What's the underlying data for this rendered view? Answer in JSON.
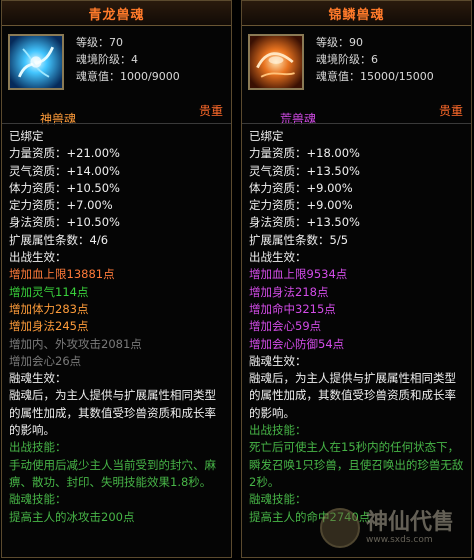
{
  "left": {
    "title": "青龙兽魂",
    "stats": [
      "等级：70",
      "魂境阶级：4",
      "魂意值：1000/9000"
    ],
    "type_label": "神兽魂",
    "type_color": "#ff9c3a",
    "rarity": "贵重",
    "lines": [
      {
        "t": "已绑定",
        "c": "white"
      },
      {
        "t": "力量资质：+21.00%",
        "c": "white"
      },
      {
        "t": "灵气资质：+14.00%",
        "c": "white"
      },
      {
        "t": "体力资质：+10.50%",
        "c": "white"
      },
      {
        "t": "定力资质：+7.00%",
        "c": "white"
      },
      {
        "t": "身法资质：+10.50%",
        "c": "white"
      },
      {
        "t": "扩展属性条数：4/6",
        "c": "white"
      },
      {
        "t": "出战生效：",
        "c": "white"
      },
      {
        "t": "增加血上限13881点",
        "c": "red"
      },
      {
        "t": "增加灵气114点",
        "c": "green"
      },
      {
        "t": "增加体力283点",
        "c": "orange"
      },
      {
        "t": "增加身法245点",
        "c": "orange"
      },
      {
        "t": "增加内、外攻攻击2081点",
        "c": "gray"
      },
      {
        "t": "增加会心26点",
        "c": "gray"
      },
      {
        "t": "融魂生效：",
        "c": "white"
      },
      {
        "t": "融魂后，为主人提供与扩展属性相同类型的属性加成，其数值受珍兽资质和成长率的影响。",
        "c": "white",
        "p": true
      },
      {
        "t": "出战技能：",
        "c": "dgreen"
      },
      {
        "t": "手动使用后减少主人当前受到的封穴、麻痹、散功、封印、失明技能效果1.8秒。",
        "c": "dgreen",
        "p": true
      },
      {
        "t": "融魂技能：",
        "c": "dgreen"
      },
      {
        "t": "提高主人的冰攻击200点",
        "c": "dgreen"
      }
    ]
  },
  "right": {
    "title": "锦鳞兽魂",
    "stats": [
      "等级：90",
      "魂境阶级：6",
      "魂意值：15000/15000"
    ],
    "type_label": "荒兽魂",
    "type_color": "#d34ce8",
    "rarity": "贵重",
    "lines": [
      {
        "t": "已绑定",
        "c": "white"
      },
      {
        "t": "力量资质：+18.00%",
        "c": "white"
      },
      {
        "t": "灵气资质：+13.50%",
        "c": "white"
      },
      {
        "t": "体力资质：+9.00%",
        "c": "white"
      },
      {
        "t": "定力资质：+9.00%",
        "c": "white"
      },
      {
        "t": "身法资质：+13.50%",
        "c": "white"
      },
      {
        "t": "扩展属性条数：5/5",
        "c": "white"
      },
      {
        "t": "出战生效：",
        "c": "white"
      },
      {
        "t": "增加血上限9534点",
        "c": "purple"
      },
      {
        "t": "增加身法218点",
        "c": "purple"
      },
      {
        "t": "增加命中3215点",
        "c": "purple"
      },
      {
        "t": "增加会心59点",
        "c": "purple"
      },
      {
        "t": "增加会心防御54点",
        "c": "purple"
      },
      {
        "t": "融魂生效：",
        "c": "white"
      },
      {
        "t": "融魂后，为主人提供与扩展属性相同类型的属性加成，其数值受珍兽资质和成长率的影响。",
        "c": "white",
        "p": true
      },
      {
        "t": "出战技能：",
        "c": "dgreen"
      },
      {
        "t": "死亡后可使主人在15秒内的任何状态下，瞬发召唤1只珍兽，且使召唤出的珍兽无敌2秒。",
        "c": "dgreen",
        "p": true
      },
      {
        "t": "融魂技能：",
        "c": "dgreen"
      },
      {
        "t": "提高主人的命中2740点",
        "c": "dgreen"
      }
    ]
  },
  "watermark": {
    "text": "神仙代售",
    "url": "www.sxds.com"
  }
}
